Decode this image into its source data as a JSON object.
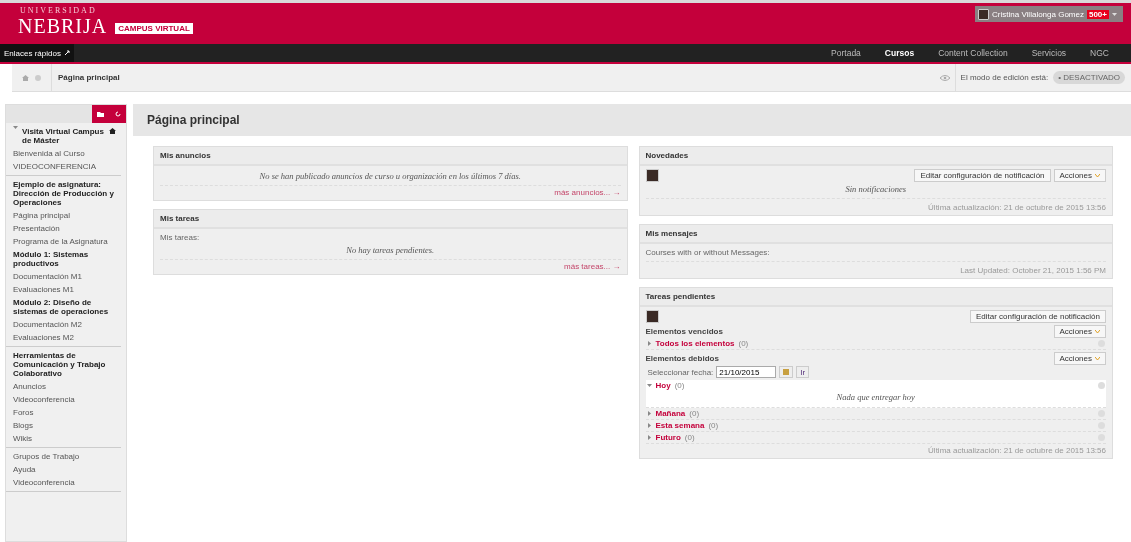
{
  "header": {
    "logo_top": "UNIVERSIDAD",
    "logo_main": "NEBRIJA",
    "logo_tag": "CAMPUS VIRTUAL",
    "user": {
      "name": "Cristina Villalonga Gomez",
      "badge": "500+"
    }
  },
  "nav": {
    "quick_links": "Enlaces rápidos",
    "tabs": [
      {
        "label": "Portada",
        "selected": false
      },
      {
        "label": "Cursos",
        "selected": true
      },
      {
        "label": "Content Collection",
        "selected": false
      },
      {
        "label": "Servicios",
        "selected": false
      },
      {
        "label": "NGC",
        "selected": false
      }
    ]
  },
  "breadcrumb": {
    "current": "Página principal",
    "edit_mode": {
      "label": "El modo de edición está:",
      "state": "• DESACTIVADO",
      "on": false
    }
  },
  "sidebar": {
    "groups": [
      {
        "items": [
          {
            "kind": "course",
            "label": "Visita Virtual Campus de Máster"
          },
          {
            "kind": "link",
            "label": "Bienvenida al Curso"
          },
          {
            "kind": "link",
            "label": "VIDEOCONFERENCIA"
          }
        ]
      },
      {
        "items": [
          {
            "kind": "heading",
            "label": "Ejemplo de asignatura: Dirección de Producción y Operaciones"
          },
          {
            "kind": "link",
            "label": "Página principal"
          },
          {
            "kind": "link",
            "label": "Presentación"
          },
          {
            "kind": "link",
            "label": "Programa de la Asignatura"
          },
          {
            "kind": "heading",
            "label": "Módulo 1: Sistemas productivos"
          },
          {
            "kind": "link",
            "label": "Documentación M1"
          },
          {
            "kind": "link",
            "label": "Evaluaciones M1"
          },
          {
            "kind": "heading",
            "label": "Módulo 2: Diseño de sistemas de operaciones"
          },
          {
            "kind": "link",
            "label": "Documentación M2"
          },
          {
            "kind": "link",
            "label": "Evaluaciones M2"
          }
        ]
      },
      {
        "items": [
          {
            "kind": "heading",
            "label": "Herramientas de Comunicación y Trabajo Colaborativo"
          },
          {
            "kind": "link",
            "label": "Anuncios"
          },
          {
            "kind": "link",
            "label": "Videoconferencia"
          },
          {
            "kind": "link",
            "label": "Foros"
          },
          {
            "kind": "link",
            "label": "Blogs"
          },
          {
            "kind": "link",
            "label": "Wikis"
          }
        ]
      },
      {
        "items": [
          {
            "kind": "link",
            "label": "Grupos de Trabajo"
          },
          {
            "kind": "link",
            "label": "Ayuda"
          },
          {
            "kind": "link",
            "label": "Videoconferencia"
          }
        ]
      }
    ]
  },
  "page_title": "Página principal",
  "left_modules": [
    {
      "title": "Mis anuncios",
      "message": "No se han publicado anuncios de curso u organización en los últimos 7 días.",
      "more": "más anuncios... →"
    },
    {
      "title": "Mis tareas",
      "intro": "Mis tareas:",
      "message": "No hay tareas pendientes.",
      "more": "más tareas... →"
    }
  ],
  "novedades": {
    "title": "Novedades",
    "edit_button": "Editar configuración de notificación",
    "actions_button": "Acciones",
    "message": "Sin notificaciones",
    "updated": "Última actualización: 21 de octubre de 2015 13:56"
  },
  "mensajes": {
    "title": "Mis mensajes",
    "intro": "Courses with or without Messages:",
    "updated": "Last Updated: October 21, 2015 1:56 PM"
  },
  "tareas_pendientes": {
    "title": "Tareas pendientes",
    "edit_button": "Editar configuración de notificación",
    "overdue": {
      "title": "Elementos vencidos",
      "actions_button": "Acciones",
      "rows": [
        {
          "label": "Todos los elementos",
          "count": "(0)",
          "expanded": false
        }
      ]
    },
    "due": {
      "title": "Elementos debidos",
      "actions_button": "Acciones",
      "date_label": "Seleccionar fecha:",
      "date_value": "21/10/2015",
      "go_button": "Ir",
      "rows": [
        {
          "label": "Hoy",
          "count": "(0)",
          "expanded": true,
          "empty_text": "Nada que entregar hoy"
        },
        {
          "label": "Mañana",
          "count": "(0)",
          "expanded": false
        },
        {
          "label": "Esta semana",
          "count": "(0)",
          "expanded": false
        },
        {
          "label": "Futuro",
          "count": "(0)",
          "expanded": false
        }
      ]
    },
    "updated": "Última actualización: 21 de octubre de 2015 13:56"
  }
}
